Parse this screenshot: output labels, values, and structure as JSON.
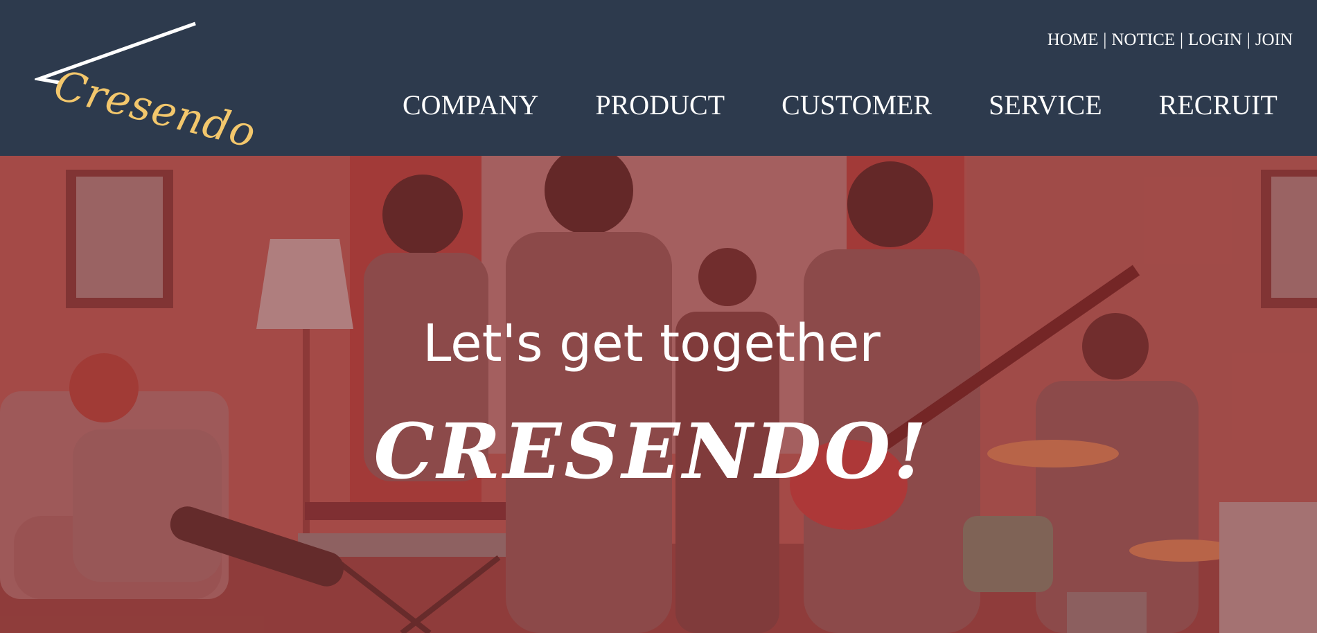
{
  "header": {
    "logo_text": "Cresendo",
    "util_nav": {
      "home": "HOME",
      "notice": "NOTICE",
      "login": "LOGIN",
      "join": "JOIN",
      "separator": "|"
    },
    "main_nav": [
      "COMPANY",
      "PRODUCT",
      "CUSTOMER",
      "SERVICE",
      "RECRUIT"
    ]
  },
  "hero": {
    "line1": "Let's get together",
    "line2": "CRESENDO!"
  },
  "colors": {
    "header_bg": "#2d3a4d",
    "logo_accent": "#f3c76c",
    "hero_tint": "#a64a48",
    "text": "#ffffff"
  }
}
